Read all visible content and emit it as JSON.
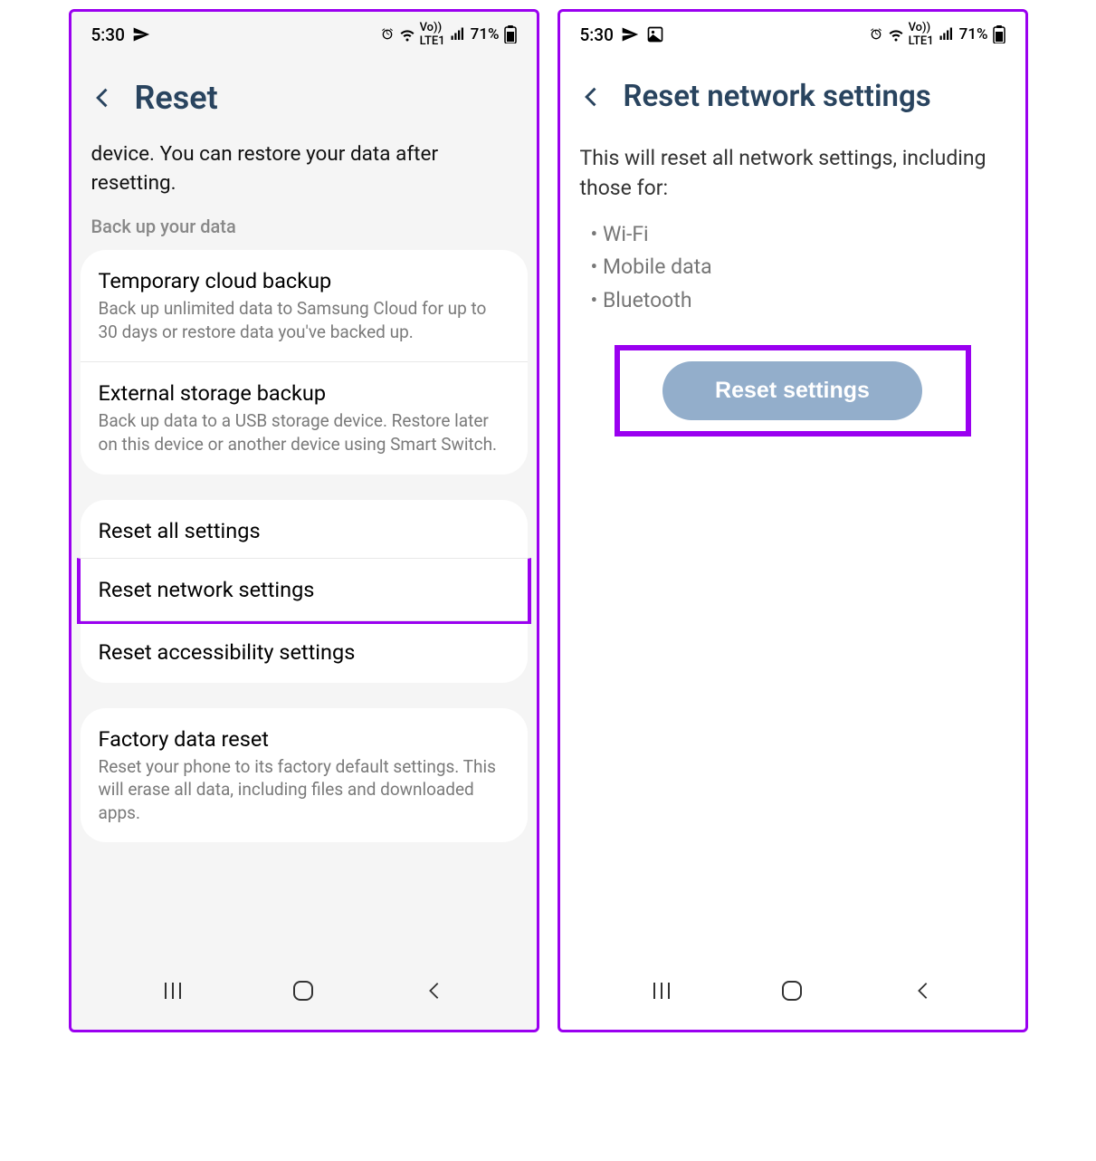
{
  "status": {
    "time": "5:30",
    "battery_text": "71%"
  },
  "left": {
    "title": "Reset",
    "intro": "device. You can restore your data after resetting.",
    "section_label": "Back up your data",
    "backup_card": [
      {
        "title": "Temporary cloud backup",
        "sub": "Back up unlimited data to Samsung Cloud for up to 30 days or restore data you've backed up."
      },
      {
        "title": "External storage backup",
        "sub": "Back up data to a USB storage device. Restore later on this device or another device using Smart Switch."
      }
    ],
    "reset_card": [
      {
        "title": "Reset all settings"
      },
      {
        "title": "Reset network settings"
      },
      {
        "title": "Reset accessibility settings"
      }
    ],
    "factory_card": {
      "title": "Factory data reset",
      "sub": "Reset your phone to its factory default settings. This will erase all data, including files and downloaded apps."
    }
  },
  "right": {
    "title": "Reset network settings",
    "desc": "This will reset all network settings, including those for:",
    "bullets": [
      "Wi-Fi",
      "Mobile data",
      "Bluetooth"
    ],
    "button": "Reset settings"
  }
}
